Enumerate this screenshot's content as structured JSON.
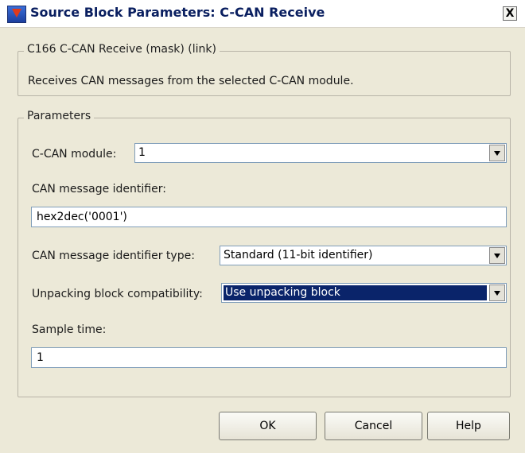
{
  "window": {
    "title": "Source Block Parameters: C-CAN Receive",
    "close_label": "X"
  },
  "description_group": {
    "legend": "C166 C-CAN Receive (mask) (link)",
    "text": "Receives CAN messages from the selected C-CAN module."
  },
  "parameters_group": {
    "legend": "Parameters",
    "ccan_module": {
      "label": "C-CAN module:",
      "value": "1"
    },
    "can_identifier": {
      "label": "CAN message identifier:",
      "value": "hex2dec('0001')"
    },
    "identifier_type": {
      "label": "CAN message identifier type:",
      "value": "Standard (11-bit identifier)"
    },
    "unpacking": {
      "label": "Unpacking block compatibility:",
      "value": "Use unpacking block"
    },
    "sample_time": {
      "label": "Sample time:",
      "value": "1"
    }
  },
  "buttons": {
    "ok": "OK",
    "cancel": "Cancel",
    "help": "Help"
  }
}
